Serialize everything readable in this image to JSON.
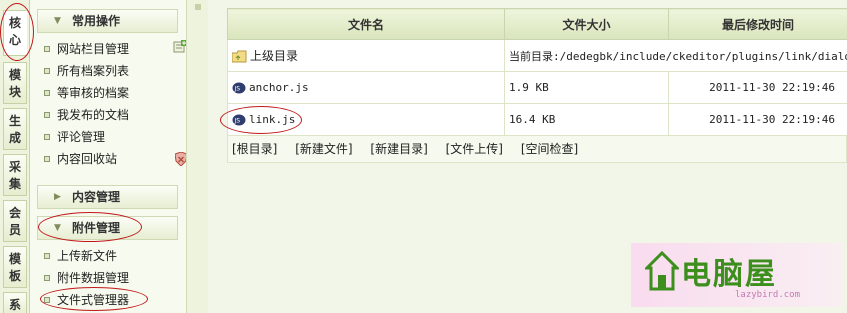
{
  "vtabs": [
    {
      "label": [
        "核",
        "心"
      ],
      "active": true
    },
    {
      "label": [
        "模",
        "块"
      ],
      "active": false
    },
    {
      "label": [
        "生",
        "成"
      ],
      "active": false
    },
    {
      "label": [
        "采",
        "集"
      ],
      "active": false
    },
    {
      "label": [
        "会",
        "员"
      ],
      "active": false
    },
    {
      "label": [
        "模",
        "板"
      ],
      "active": false
    },
    {
      "label": [
        "系"
      ],
      "active": false
    }
  ],
  "menu": {
    "section1": "常用操作",
    "items1": [
      "网站栏目管理",
      "所有档案列表",
      "等审核的档案",
      "我发布的文档",
      "评论管理",
      "内容回收站"
    ],
    "section2": "内容管理",
    "section3": "附件管理",
    "items3": [
      "上传新文件",
      "附件数据管理",
      "文件式管理器"
    ]
  },
  "table": {
    "headers": [
      "文件名",
      "文件大小",
      "最后修改时间"
    ],
    "parent_dir": "上级目录",
    "current_dir": "当前目录:/dedegbk/include/ckeditor/plugins/link/dialogs",
    "files": [
      {
        "name": "anchor.js",
        "size": "1.9 KB",
        "modified": "2011-11-30 22:19:46"
      },
      {
        "name": "link.js",
        "size": "16.4 KB",
        "modified": "2011-11-30 22:19:46"
      }
    ]
  },
  "toolbar": [
    "[根目录]",
    "[新建文件]",
    "[新建目录]",
    "[文件上传]",
    "[空间检查]"
  ],
  "watermark": {
    "text": "电脑屋",
    "url": "lazybird.com"
  },
  "colors": {
    "annotation": "#c01818",
    "header_bg": "#dde8c2",
    "panel_bg": "#f2f6e8"
  }
}
